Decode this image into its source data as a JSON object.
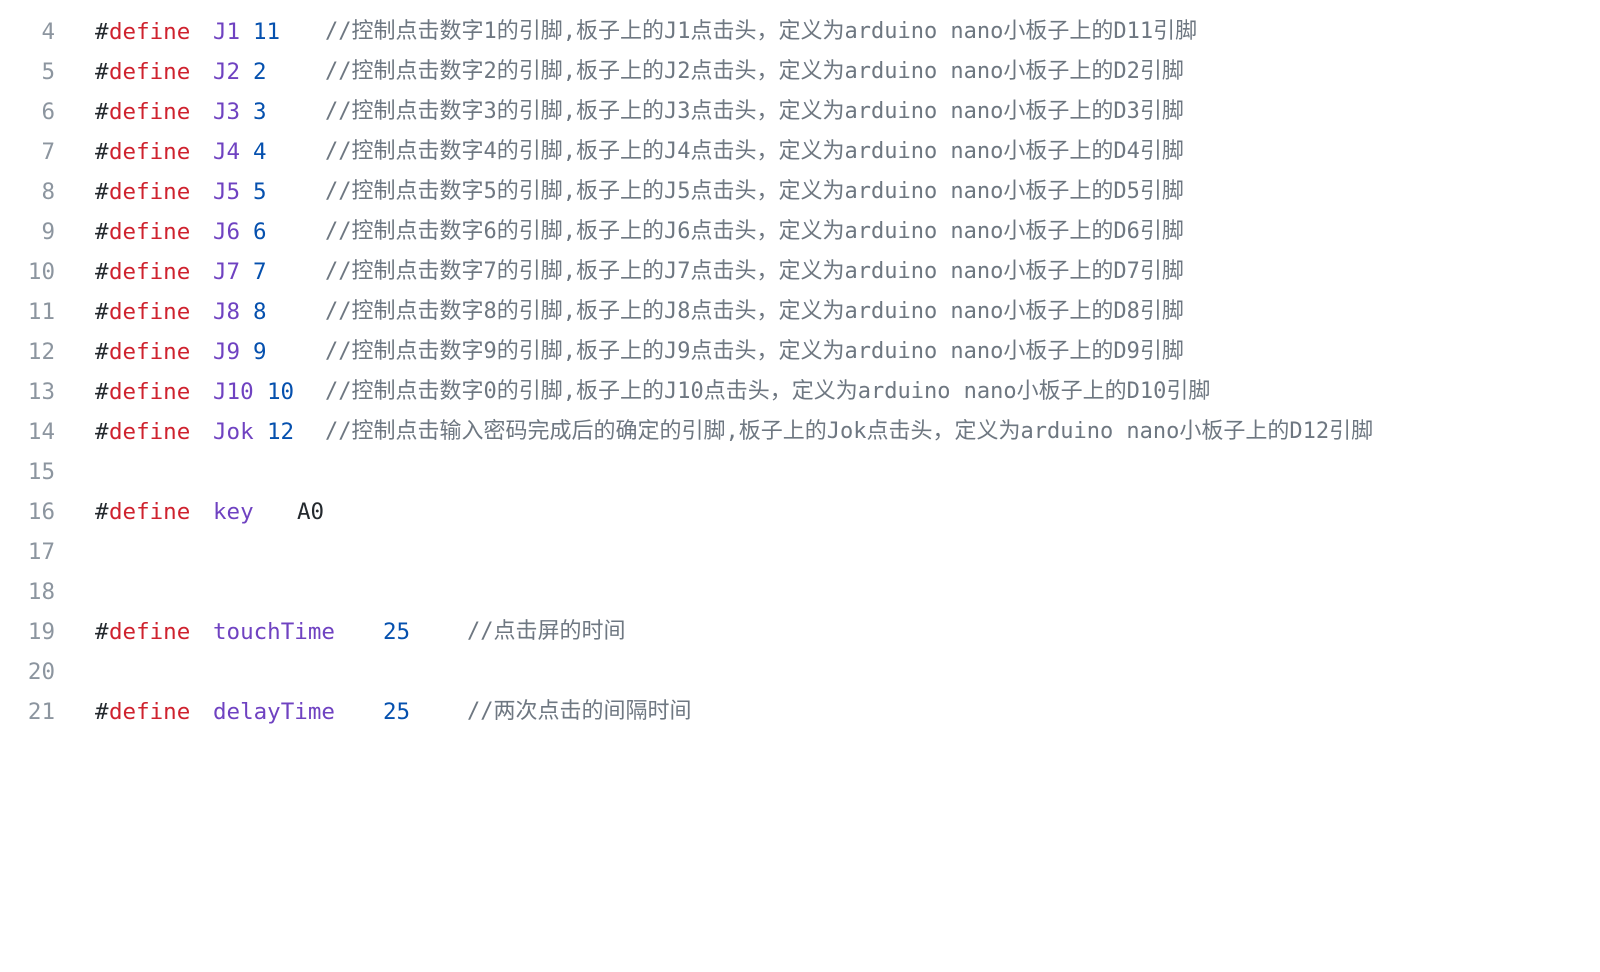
{
  "editor": {
    "lines": [
      {
        "n": "4",
        "hash": "#",
        "kw": "define",
        "name": "J1",
        "val": "11",
        "cmt": "//控制点击数字1的引脚,板子上的J1点击头，定义为arduino nano小板子上的D11引脚"
      },
      {
        "n": "5",
        "hash": "#",
        "kw": "define",
        "name": "J2",
        "val": "2",
        "cmt": "//控制点击数字2的引脚,板子上的J2点击头，定义为arduino nano小板子上的D2引脚"
      },
      {
        "n": "6",
        "hash": "#",
        "kw": "define",
        "name": "J3",
        "val": "3",
        "cmt": "//控制点击数字3的引脚,板子上的J3点击头，定义为arduino nano小板子上的D3引脚"
      },
      {
        "n": "7",
        "hash": "#",
        "kw": "define",
        "name": "J4",
        "val": "4",
        "cmt": "//控制点击数字4的引脚,板子上的J4点击头，定义为arduino nano小板子上的D4引脚"
      },
      {
        "n": "8",
        "hash": "#",
        "kw": "define",
        "name": "J5",
        "val": "5",
        "cmt": "//控制点击数字5的引脚,板子上的J5点击头，定义为arduino nano小板子上的D5引脚"
      },
      {
        "n": "9",
        "hash": "#",
        "kw": "define",
        "name": "J6",
        "val": "6",
        "cmt": "//控制点击数字6的引脚,板子上的J6点击头，定义为arduino nano小板子上的D6引脚"
      },
      {
        "n": "10",
        "hash": "#",
        "kw": "define",
        "name": "J7",
        "val": "7",
        "cmt": "//控制点击数字7的引脚,板子上的J7点击头，定义为arduino nano小板子上的D7引脚"
      },
      {
        "n": "11",
        "hash": "#",
        "kw": "define",
        "name": "J8",
        "val": "8",
        "cmt": "//控制点击数字8的引脚,板子上的J8点击头，定义为arduino nano小板子上的D8引脚"
      },
      {
        "n": "12",
        "hash": "#",
        "kw": "define",
        "name": "J9",
        "val": "9",
        "cmt": "//控制点击数字9的引脚,板子上的J9点击头，定义为arduino nano小板子上的D9引脚"
      },
      {
        "n": "13",
        "hash": "#",
        "kw": "define",
        "name": "J10",
        "val": "10",
        "cmt": "//控制点击数字0的引脚,板子上的J10点击头，定义为arduino nano小板子上的D10引脚"
      },
      {
        "n": "14",
        "hash": "#",
        "kw": "define",
        "name": "Jok",
        "val": "12",
        "cmt": "//控制点击输入密码完成后的确定的引脚,板子上的Jok点击头，定义为arduino nano小板子上的D12引脚"
      },
      {
        "n": "15"
      },
      {
        "n": "16",
        "hash": "#",
        "kw": "define",
        "name": "key",
        "val": "A0"
      },
      {
        "n": "17"
      },
      {
        "n": "18"
      },
      {
        "n": "19",
        "hash": "#",
        "kw": "define",
        "name": "touchTime",
        "val": "25",
        "cmt": "//点击屏的时间"
      },
      {
        "n": "20"
      },
      {
        "n": "21",
        "hash": "#",
        "kw": "define",
        "name": "delayTime",
        "val": "25",
        "cmt": "//两次点击的间隔时间"
      }
    ]
  }
}
